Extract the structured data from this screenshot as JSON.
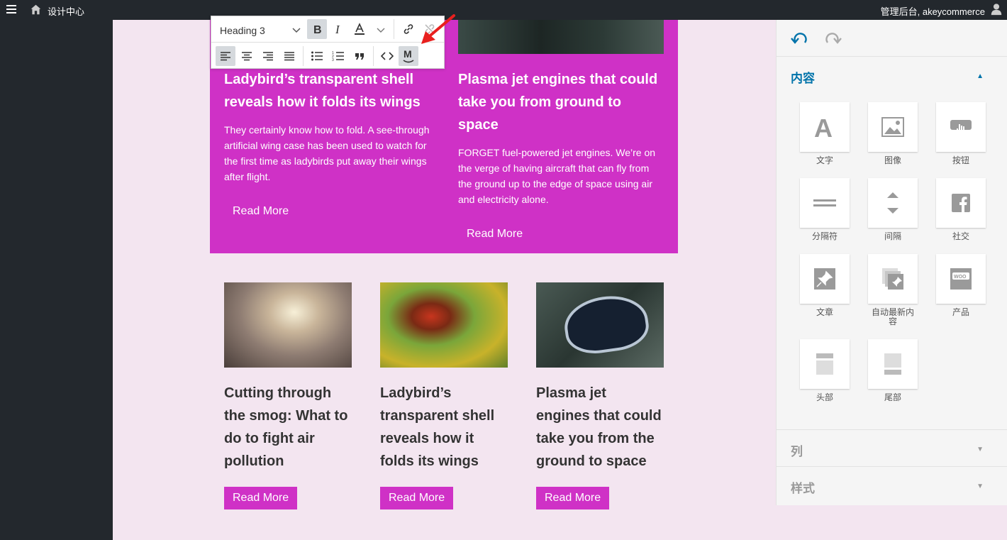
{
  "topbar": {
    "site_name": "设计中心",
    "user_text": "管理后台, akeycommerce"
  },
  "toolbar": {
    "block_format": "Heading 3"
  },
  "featured": [
    {
      "title": "Ladybird’s transparent shell reveals how it folds its wings",
      "excerpt": "They certainly know how to fold. A see-through artificial wing case has been used to watch for the first time as ladybirds put away their wings after flight.",
      "read_more": "Read More"
    },
    {
      "title": "Plasma jet engines that could take you from ground to space",
      "excerpt": "FORGET fuel-powered jet engines. We’re on the verge of having aircraft that can fly from the ground up to the edge of space using air and electricity alone.",
      "read_more": "Read More"
    }
  ],
  "posts": [
    {
      "title": "Cutting through the smog: What to do to fight air pollution",
      "read_more": "Read More"
    },
    {
      "title": "Ladybird’s transparent shell reveals how it folds its wings",
      "read_more": "Read More"
    },
    {
      "title": "Plasma jet engines that could take you from the ground to space",
      "read_more": "Read More"
    }
  ],
  "panel": {
    "content_heading": "内容",
    "columns_heading": "列",
    "style_heading": "样式",
    "tiles": [
      {
        "label": "文字",
        "icon": "text-icon"
      },
      {
        "label": "图像",
        "icon": "image-icon"
      },
      {
        "label": "按钮",
        "icon": "button-icon"
      },
      {
        "label": "分隔符",
        "icon": "divider-icon"
      },
      {
        "label": "间隔",
        "icon": "spacer-icon"
      },
      {
        "label": "社交",
        "icon": "facebook-icon"
      },
      {
        "label": "文章",
        "icon": "post-pin-icon"
      },
      {
        "label": "自动最新内容",
        "icon": "latest-content-icon"
      },
      {
        "label": "产品",
        "icon": "woo-product-icon"
      },
      {
        "label": "头部",
        "icon": "header-icon"
      },
      {
        "label": "尾部",
        "icon": "footer-icon"
      }
    ]
  },
  "colors": {
    "accent": "#cf31c6",
    "canvas_bg": "#f3e5f0",
    "admin_bar": "#23282d",
    "panel_link": "#0073aa",
    "annotation_arrow": "#e8201e"
  }
}
